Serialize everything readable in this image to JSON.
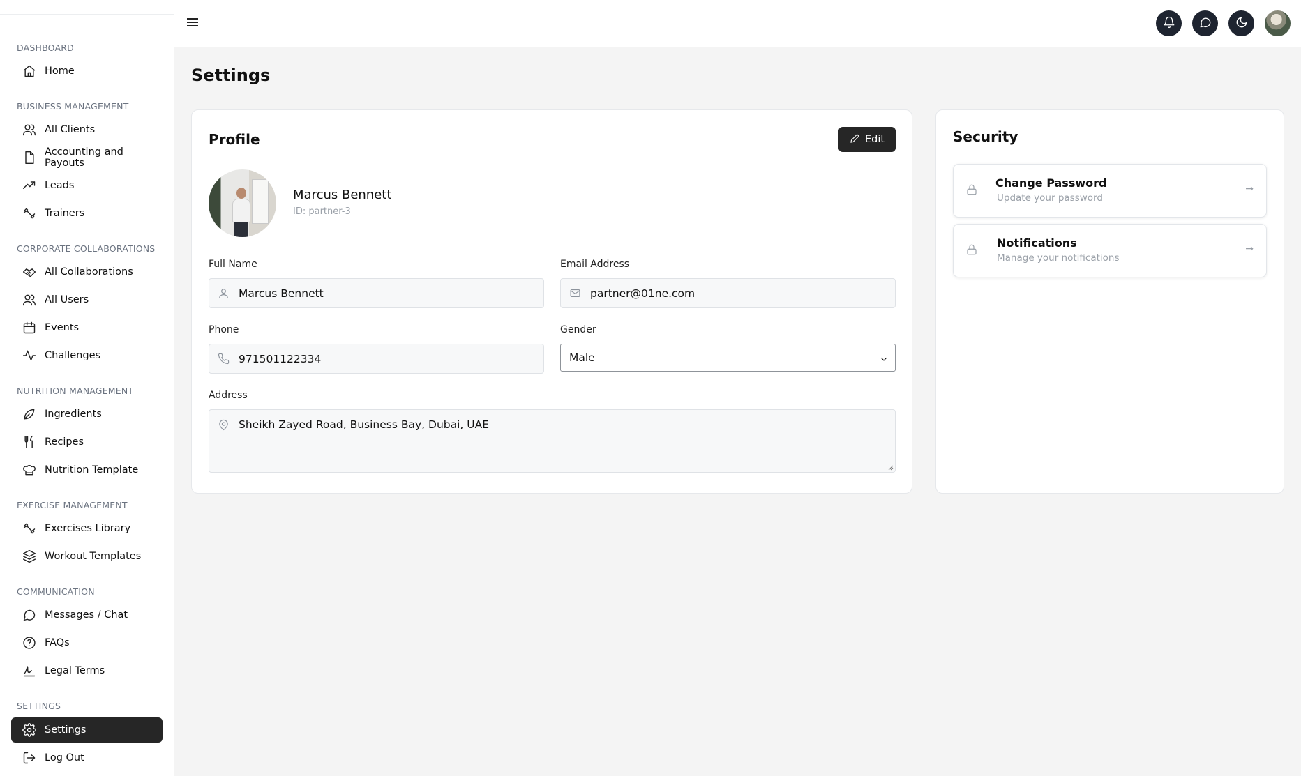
{
  "sidebar": {
    "sections": [
      {
        "title": "DASHBOARD",
        "items": [
          {
            "label": "Home",
            "icon": "home-icon"
          }
        ]
      },
      {
        "title": "BUSINESS MANAGEMENT",
        "items": [
          {
            "label": "All Clients",
            "icon": "users-icon"
          },
          {
            "label": "Accounting and Payouts",
            "icon": "file-icon"
          },
          {
            "label": "Leads",
            "icon": "trending-up-icon"
          },
          {
            "label": "Trainers",
            "icon": "dumbbell-icon"
          }
        ]
      },
      {
        "title": "CORPORATE COLLABORATIONS",
        "items": [
          {
            "label": "All Collaborations",
            "icon": "handshake-icon"
          },
          {
            "label": "All Users",
            "icon": "users-icon"
          },
          {
            "label": "Events",
            "icon": "calendar-icon"
          },
          {
            "label": "Challenges",
            "icon": "activity-icon"
          }
        ]
      },
      {
        "title": "NUTRITION MANAGEMENT",
        "items": [
          {
            "label": "Ingredients",
            "icon": "leaf-icon"
          },
          {
            "label": "Recipes",
            "icon": "utensils-icon"
          },
          {
            "label": "Nutrition Template",
            "icon": "chef-hat-icon"
          }
        ]
      },
      {
        "title": "EXERCISE MANAGEMENT",
        "items": [
          {
            "label": "Exercises Library",
            "icon": "dumbbell-icon"
          },
          {
            "label": "Workout Templates",
            "icon": "layers-icon"
          }
        ]
      },
      {
        "title": "COMMUNICATION",
        "items": [
          {
            "label": "Messages / Chat",
            "icon": "message-circle-icon"
          },
          {
            "label": "FAQs",
            "icon": "help-circle-icon"
          },
          {
            "label": "Legal Terms",
            "icon": "signature-icon"
          }
        ]
      },
      {
        "title": "SETTINGS",
        "items": [
          {
            "label": "Settings",
            "icon": "gear-icon",
            "active": true
          },
          {
            "label": "Log Out",
            "icon": "log-out-icon"
          }
        ]
      }
    ]
  },
  "header": {
    "buttons": [
      "bell-icon",
      "message-circle-icon",
      "moon-icon"
    ],
    "dark_color": "#1e2430"
  },
  "page": {
    "title": "Settings"
  },
  "profile": {
    "title": "Profile",
    "edit_label": "Edit",
    "name": "Marcus Bennett",
    "id_text": "ID: partner-3",
    "fields": {
      "full_name_label": "Full Name",
      "full_name": "Marcus Bennett",
      "email_label": "Email Address",
      "email": "partner@01ne.com",
      "phone_label": "Phone",
      "phone": "971501122334",
      "gender_label": "Gender",
      "gender": "Male",
      "address_label": "Address",
      "address": "Sheikh Zayed Road, Business Bay, Dubai, UAE"
    }
  },
  "security": {
    "title": "Security",
    "items": [
      {
        "title": "Change Password",
        "subtitle": "Update your password",
        "arrow": "→"
      },
      {
        "title": "Notifications",
        "subtitle": "Manage your notifications",
        "arrow": "→"
      }
    ]
  },
  "colors": {
    "accent": "#262626",
    "muted": "#9aa0a8",
    "background": "#f4f4f4"
  }
}
